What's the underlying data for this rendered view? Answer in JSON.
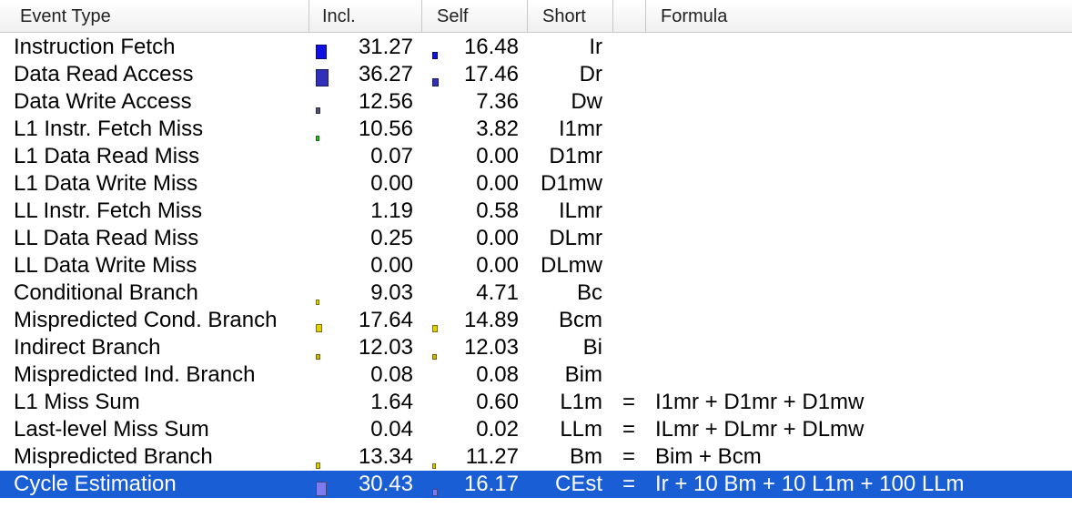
{
  "header": {
    "event_type": "Event Type",
    "incl": "Incl.",
    "self": "Self",
    "short": "Short",
    "formula": "Formula"
  },
  "rows": [
    {
      "name": "Instruction Fetch",
      "incl": "31.27",
      "self": "16.48",
      "short": "Ir",
      "eq": "",
      "formula": "",
      "incl_bar": 0.31,
      "self_bar": 0.16,
      "bar_color": "#1010e0"
    },
    {
      "name": "Data Read Access",
      "incl": "36.27",
      "self": "17.46",
      "short": "Dr",
      "eq": "",
      "formula": "",
      "incl_bar": 0.36,
      "self_bar": 0.17,
      "bar_color": "#3030b8"
    },
    {
      "name": "Data Write Access",
      "incl": "12.56",
      "self": "7.36",
      "short": "Dw",
      "eq": "",
      "formula": "",
      "incl_bar": 0.13,
      "self_bar": 0,
      "bar_color": "#505070"
    },
    {
      "name": "L1 Instr. Fetch Miss",
      "incl": "10.56",
      "self": "3.82",
      "short": "I1mr",
      "eq": "",
      "formula": "",
      "incl_bar": 0.11,
      "self_bar": 0,
      "bar_color": "#20c020"
    },
    {
      "name": "L1 Data Read Miss",
      "incl": "0.07",
      "self": "0.00",
      "short": "D1mr",
      "eq": "",
      "formula": "",
      "incl_bar": 0,
      "self_bar": 0,
      "bar_color": "#808080"
    },
    {
      "name": "L1 Data Write Miss",
      "incl": "0.00",
      "self": "0.00",
      "short": "D1mw",
      "eq": "",
      "formula": "",
      "incl_bar": 0,
      "self_bar": 0,
      "bar_color": "#808080"
    },
    {
      "name": "LL Instr. Fetch Miss",
      "incl": "1.19",
      "self": "0.58",
      "short": "ILmr",
      "eq": "",
      "formula": "",
      "incl_bar": 0,
      "self_bar": 0,
      "bar_color": "#808080"
    },
    {
      "name": "LL Data Read Miss",
      "incl": "0.25",
      "self": "0.00",
      "short": "DLmr",
      "eq": "",
      "formula": "",
      "incl_bar": 0,
      "self_bar": 0,
      "bar_color": "#808080"
    },
    {
      "name": "LL Data Write Miss",
      "incl": "0.00",
      "self": "0.00",
      "short": "DLmw",
      "eq": "",
      "formula": "",
      "incl_bar": 0,
      "self_bar": 0,
      "bar_color": "#808080"
    },
    {
      "name": "Conditional Branch",
      "incl": "9.03",
      "self": "4.71",
      "short": "Bc",
      "eq": "",
      "formula": "",
      "incl_bar": 0.09,
      "self_bar": 0,
      "bar_color": "#e0d000"
    },
    {
      "name": "Mispredicted Cond. Branch",
      "incl": "17.64",
      "self": "14.89",
      "short": "Bcm",
      "eq": "",
      "formula": "",
      "incl_bar": 0.18,
      "self_bar": 0.15,
      "bar_color": "#e0d000"
    },
    {
      "name": "Indirect Branch",
      "incl": "12.03",
      "self": "12.03",
      "short": "Bi",
      "eq": "",
      "formula": "",
      "incl_bar": 0.12,
      "self_bar": 0.12,
      "bar_color": "#c8b800"
    },
    {
      "name": "Mispredicted Ind. Branch",
      "incl": "0.08",
      "self": "0.08",
      "short": "Bim",
      "eq": "",
      "formula": "",
      "incl_bar": 0,
      "self_bar": 0,
      "bar_color": "#808080"
    },
    {
      "name": "L1 Miss Sum",
      "incl": "1.64",
      "self": "0.60",
      "short": "L1m",
      "eq": "=",
      "formula": "I1mr + D1mr + D1mw",
      "incl_bar": 0,
      "self_bar": 0,
      "bar_color": "#808080"
    },
    {
      "name": "Last-level Miss Sum",
      "incl": "0.04",
      "self": "0.02",
      "short": "LLm",
      "eq": "=",
      "formula": "ILmr + DLmr + DLmw",
      "incl_bar": 0,
      "self_bar": 0,
      "bar_color": "#808080"
    },
    {
      "name": "Mispredicted Branch",
      "incl": "13.34",
      "self": "11.27",
      "short": "Bm",
      "eq": "=",
      "formula": "Bim + Bcm",
      "incl_bar": 0.13,
      "self_bar": 0.11,
      "bar_color": "#d8c800"
    },
    {
      "name": "Cycle Estimation",
      "incl": "30.43",
      "self": "16.17",
      "short": "CEst",
      "eq": "=",
      "formula": "Ir + 10 Bm + 10 L1m + 100 LLm",
      "incl_bar": 0.3,
      "self_bar": 0.16,
      "bar_color": "#7c7cf0",
      "selected": true
    }
  ]
}
